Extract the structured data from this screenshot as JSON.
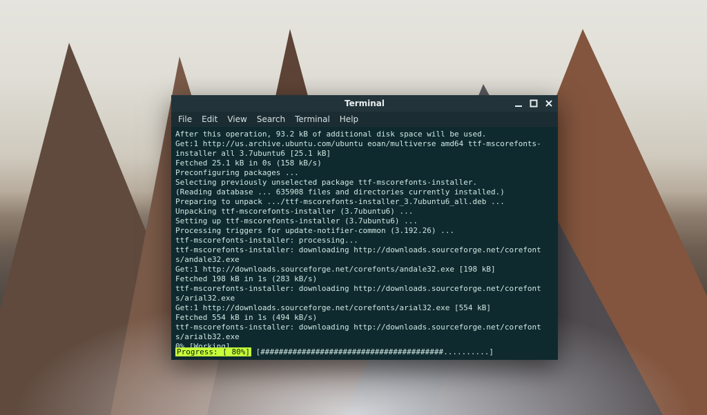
{
  "window": {
    "title": "Terminal",
    "controls": {
      "minimize": "minimize",
      "maximize": "maximize",
      "close": "close"
    }
  },
  "menubar": {
    "items": [
      "File",
      "Edit",
      "View",
      "Search",
      "Terminal",
      "Help"
    ]
  },
  "terminal": {
    "lines": [
      "After this operation, 93.2 kB of additional disk space will be used.",
      "Get:1 http://us.archive.ubuntu.com/ubuntu eoan/multiverse amd64 ttf-mscorefonts-",
      "installer all 3.7ubuntu6 [25.1 kB]",
      "Fetched 25.1 kB in 0s (158 kB/s)",
      "Preconfiguring packages ...",
      "Selecting previously unselected package ttf-mscorefonts-installer.",
      "(Reading database ... 635908 files and directories currently installed.)",
      "Preparing to unpack .../ttf-mscorefonts-installer_3.7ubuntu6_all.deb ...",
      "Unpacking ttf-mscorefonts-installer (3.7ubuntu6) ...",
      "Setting up ttf-mscorefonts-installer (3.7ubuntu6) ...",
      "Processing triggers for update-notifier-common (3.192.26) ...",
      "ttf-mscorefonts-installer: processing...",
      "ttf-mscorefonts-installer: downloading http://downloads.sourceforge.net/corefont",
      "s/andale32.exe",
      "Get:1 http://downloads.sourceforge.net/corefonts/andale32.exe [198 kB]",
      "Fetched 198 kB in 1s (283 kB/s)",
      "ttf-mscorefonts-installer: downloading http://downloads.sourceforge.net/corefont",
      "s/arial32.exe",
      "Get:1 http://downloads.sourceforge.net/corefonts/arial32.exe [554 kB]",
      "Fetched 554 kB in 1s (494 kB/s)",
      "ttf-mscorefonts-installer: downloading http://downloads.sourceforge.net/corefont",
      "s/arialb32.exe",
      "0% [Working]"
    ],
    "progress": {
      "label": "Progress: [ 80%]",
      "bar_filled": "########################################",
      "bar_empty": "..........",
      "open": " [",
      "close": "]"
    }
  }
}
